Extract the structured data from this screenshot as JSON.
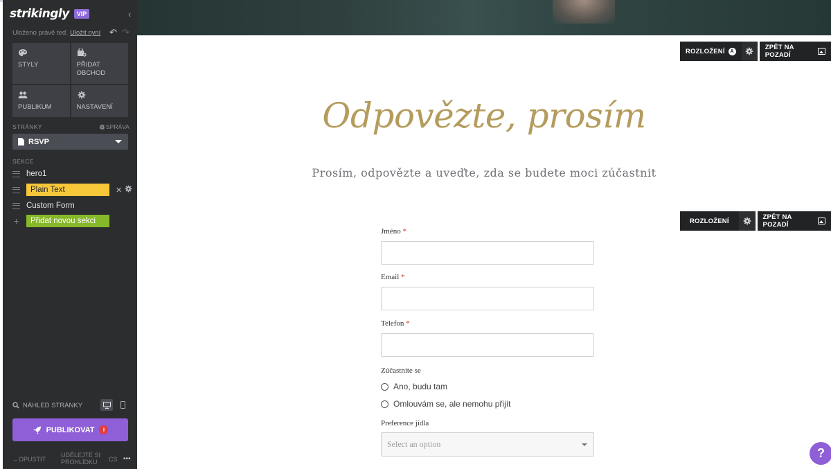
{
  "sidebar": {
    "logo": "strikingly",
    "vip_badge": "VIP",
    "saved_text": "Uloženo právě teď.",
    "save_now_link": "Uložit nyní",
    "tiles": [
      {
        "label": "STYLY",
        "icon": "palette-icon"
      },
      {
        "label": "PŘIDAT OBCHOD",
        "icon": "store-icon"
      },
      {
        "label": "PUBLIKUM",
        "icon": "people-icon"
      },
      {
        "label": "NASTAVENÍ",
        "icon": "gear-icon"
      }
    ],
    "pages_label": "STRÁNKY",
    "manage_label": "SPRÁVA",
    "current_page": "RSVP",
    "sections_label": "SEKCE",
    "sections": [
      {
        "label": "hero1"
      },
      {
        "label": "Plain Text"
      },
      {
        "label": "Custom Form"
      }
    ],
    "add_section": "Přidat novou sekci",
    "preview_label": "NÁHLED STRÁNKY",
    "publish_label": "PUBLIKOVAT",
    "footer": {
      "exit": "OPUSTIT",
      "tour": "UDĚLEJTE SI PROHLÍDKU",
      "lang": "CS",
      "more": "•••"
    }
  },
  "canvas": {
    "toolbar_top": {
      "layout": "ROZLOŽENÍ",
      "layout_badge": "A",
      "back_to_bg": "ZPĚT NA POZADÍ"
    },
    "toolbar_form": {
      "layout": "ROZLOŽENÍ",
      "back_to_bg": "ZPĚT NA POZADÍ"
    },
    "title": "Odpovězte, prosím",
    "subtitle": "Prosím, odpovězte a uveďte, zda se budete moci zúčastnit",
    "form": {
      "name_label": "Jméno",
      "email_label": "Email",
      "phone_label": "Telefon",
      "attend_label": "Zúčastníte se",
      "attend_options": [
        "Ano, budu tam",
        "Omlouvám se, ale nemohu přijít"
      ],
      "food_label": "Preference jídla",
      "food_placeholder": "Select an option",
      "required_mark": "*"
    },
    "help_icon": "?"
  },
  "colors": {
    "accent_purple": "#8e5fd6",
    "title_gold": "#b59c5d",
    "chip_yellow": "#f7c73a",
    "chip_green": "#86b92a",
    "sidebar_bg": "#2c2d2e"
  }
}
